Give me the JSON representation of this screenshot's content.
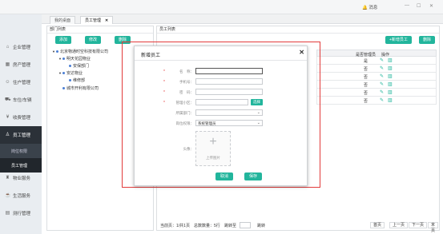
{
  "topbar": {
    "messages_label": "消息",
    "min": "—",
    "max": "☐",
    "close": "✕"
  },
  "sidebar": {
    "items": [
      {
        "label": "企业管理",
        "icon": "home-icon"
      },
      {
        "label": "房产管理",
        "icon": "building-icon"
      },
      {
        "label": "住户管理",
        "icon": "users-icon"
      },
      {
        "label": "车位/车辆",
        "icon": "car-icon"
      },
      {
        "label": "收费管理",
        "icon": "money-icon"
      },
      {
        "label": "员工管理",
        "icon": "staff-icon"
      },
      {
        "label": "物业服务",
        "icon": "service-icon"
      },
      {
        "label": "生活服务",
        "icon": "life-icon"
      },
      {
        "label": "测行管理",
        "icon": "grid-icon"
      }
    ],
    "sub_items": [
      {
        "label": "岗位权限"
      },
      {
        "label": "员工管理"
      }
    ]
  },
  "tabs": [
    {
      "label": "我的桌面"
    },
    {
      "label": "员工管理",
      "close": "✕"
    }
  ],
  "left_panel": {
    "title": "部门列表",
    "add": "添加",
    "edit": "修改",
    "delete": "删除",
    "tree": [
      {
        "label": "北京物通时空科技有限公司",
        "level": 0
      },
      {
        "label": "明天花园物业",
        "level": 1
      },
      {
        "label": "安保部门",
        "level": 2
      },
      {
        "label": "安达物业",
        "level": 1
      },
      {
        "label": "维修部",
        "level": 2
      },
      {
        "label": "城市开利有限公司",
        "level": 1
      }
    ]
  },
  "right_panel": {
    "title": "员工列表",
    "add_employee": "+新增员工",
    "delete": "删除",
    "columns": {
      "admin": "是否管理员",
      "actions": "操作"
    },
    "rows": [
      {
        "admin": "是"
      },
      {
        "admin": "否"
      },
      {
        "admin": "否"
      },
      {
        "admin": "否"
      },
      {
        "admin": "否"
      },
      {
        "admin": "否"
      }
    ],
    "pager": {
      "current": "当前页：1/共1页",
      "total": "总数数量：5行",
      "goto": "跳转至",
      "jump": "跳转",
      "first": "首页",
      "prev": "上一页",
      "next": "下一页",
      "last": "末页"
    }
  },
  "modal": {
    "title": "新增员工",
    "close": "✕",
    "fields": {
      "name_label": "名　称：",
      "phone_label": "手机号：",
      "password_label": "密　码：",
      "community_label": "管理小区：",
      "community_button": "选择",
      "dept_label": "所属部门：",
      "role_label": "岗位权限：",
      "role_value": "系统管理员",
      "avatar_label": "头像："
    },
    "upload_label": "上传图片",
    "cancel": "取消",
    "save": "保存"
  },
  "colors": {
    "accent": "#22b59c",
    "highlight": "#e23b3b",
    "sidebar_active": "#2b3138"
  }
}
